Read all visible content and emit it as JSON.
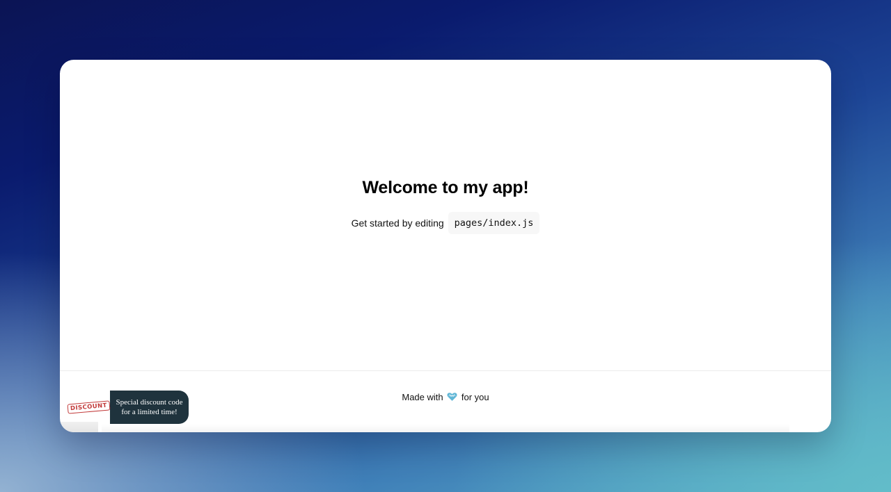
{
  "main": {
    "title": "Welcome to my app!",
    "subtitle_prefix": "Get started by editing",
    "code_path": "pages/index.js"
  },
  "footer": {
    "text_before": "Made with",
    "heart_icon": "heart-icon",
    "heart_color": "#5fb6d6",
    "text_after": "for you"
  },
  "discount_widget": {
    "stamp_label": "DISCOUNT",
    "stamp_color": "#c23a3a",
    "message_line1": "Special discount code",
    "message_line2": "for a limited time!",
    "bubble_color": "#1f333d"
  }
}
